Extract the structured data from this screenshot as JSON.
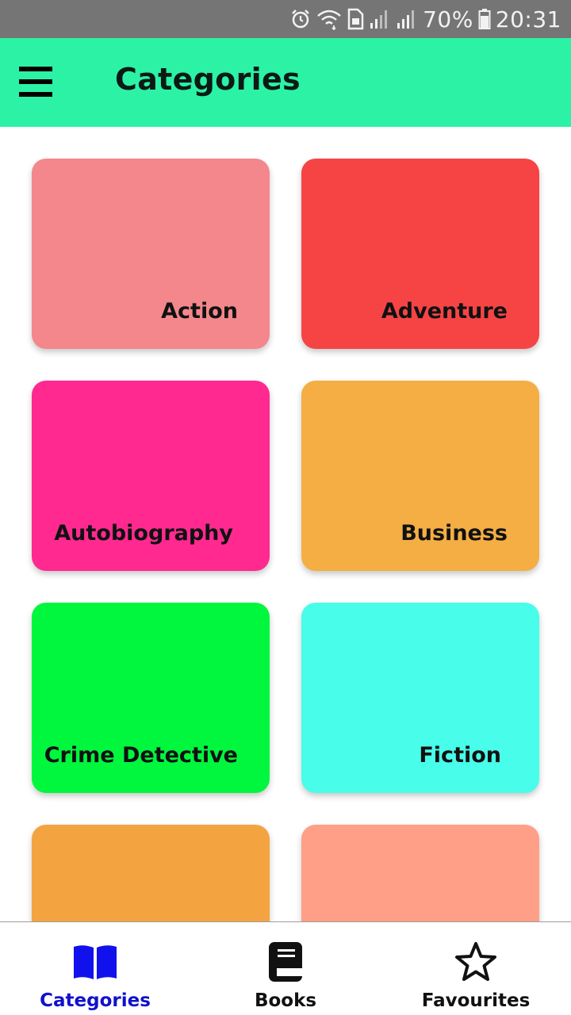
{
  "status_bar": {
    "icons": [
      "alarm-icon",
      "wifi-icon",
      "sim-icon",
      "signal-icon",
      "signal-icon",
      "battery-icon"
    ],
    "battery_percent": "70%",
    "time": "20:31",
    "background": "#757575"
  },
  "app_bar": {
    "title": "Categories",
    "menu_icon": "hamburger-menu-icon",
    "background": "#2cf2a6"
  },
  "categories": [
    {
      "label": "Action",
      "color": "#f4878b"
    },
    {
      "label": "Adventure",
      "color": "#f64445"
    },
    {
      "label": "Autobiography",
      "color": "#ff2990"
    },
    {
      "label": "Business",
      "color": "#f4ae44"
    },
    {
      "label": "Crime Detective",
      "color": "#00f73d"
    },
    {
      "label": "Fiction",
      "color": "#48fde9"
    },
    {
      "label": "",
      "color": "#f3a440"
    },
    {
      "label": "",
      "color": "#ff9f88"
    }
  ],
  "bottom_nav": {
    "active_color": "#1111cc",
    "items": [
      {
        "label": "Categories",
        "icon": "open-book-icon",
        "active": true
      },
      {
        "label": "Books",
        "icon": "book-icon",
        "active": false
      },
      {
        "label": "Favourites",
        "icon": "star-outline-icon",
        "active": false
      }
    ]
  }
}
